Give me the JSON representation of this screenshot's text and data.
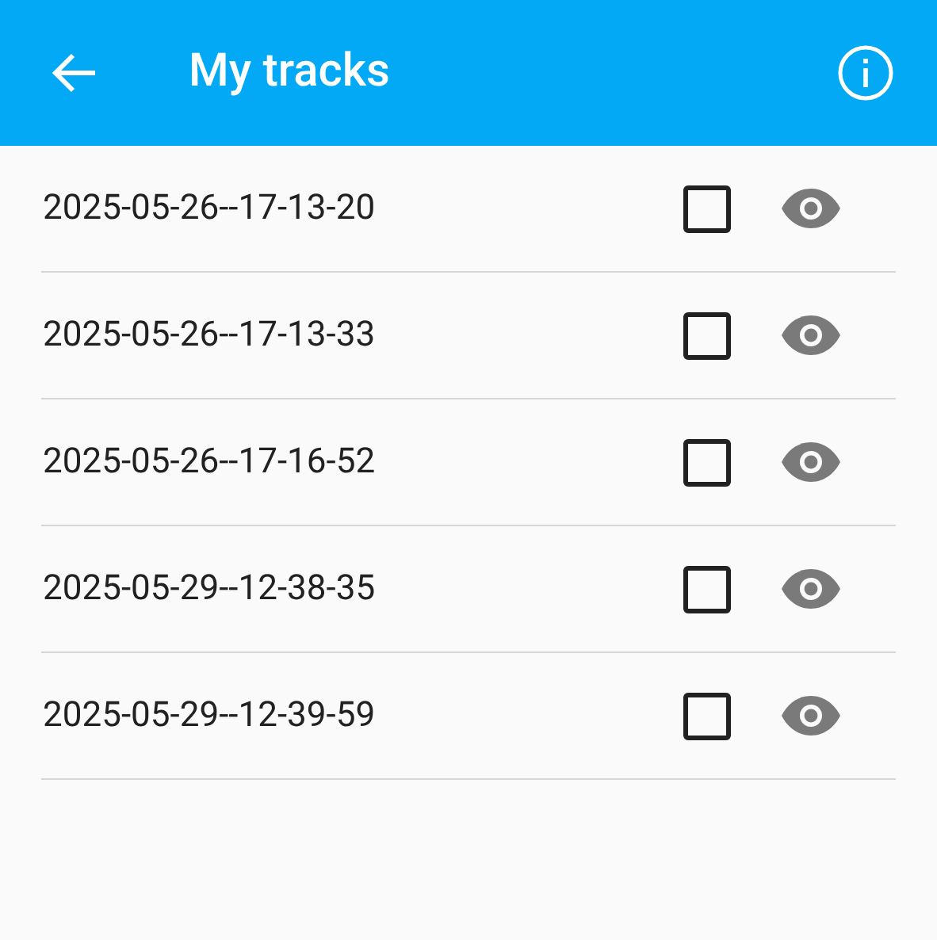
{
  "app_bar": {
    "title": "My tracks"
  },
  "tracks": [
    {
      "name": "2025-05-26--17-13-20",
      "checked": false
    },
    {
      "name": "2025-05-26--17-13-33",
      "checked": false
    },
    {
      "name": "2025-05-26--17-16-52",
      "checked": false
    },
    {
      "name": "2025-05-29--12-38-35",
      "checked": false
    },
    {
      "name": "2025-05-29--12-39-59",
      "checked": false
    }
  ]
}
